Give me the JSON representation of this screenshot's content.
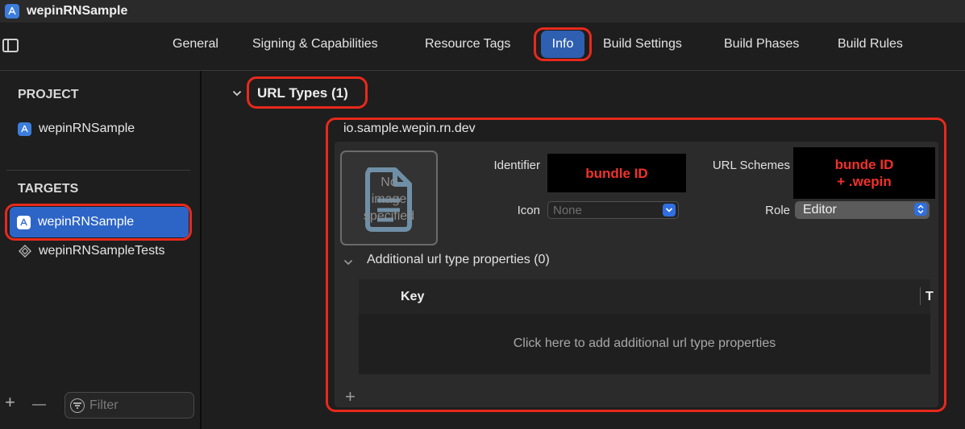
{
  "window": {
    "title": "wepinRNSample"
  },
  "tabs": [
    {
      "label": "General"
    },
    {
      "label": "Signing & Capabilities"
    },
    {
      "label": "Resource Tags"
    },
    {
      "label": "Info"
    },
    {
      "label": "Build Settings"
    },
    {
      "label": "Build Phases"
    },
    {
      "label": "Build Rules"
    }
  ],
  "sidebar": {
    "project_heading": "PROJECT",
    "project_item": "wepinRNSample",
    "targets_heading": "TARGETS",
    "targets": [
      {
        "label": "wepinRNSample"
      },
      {
        "label": "wepinRNSampleTests"
      }
    ],
    "filter_placeholder": "Filter",
    "add_label": "+",
    "remove_label": "—"
  },
  "url_types": {
    "section_title": "URL Types (1)",
    "entry_title": "io.sample.wepin.rn.dev",
    "image_placeholder": [
      "No",
      "image",
      "specified"
    ],
    "identifier_label": "Identifier",
    "identifier_value": "bundle ID",
    "url_schemes_label": "URL Schemes",
    "url_schemes_value": [
      "bunde ID",
      "+ .wepin"
    ],
    "icon_label": "Icon",
    "icon_value": "None",
    "role_label": "Role",
    "role_value": "Editor",
    "additional_label": "Additional url type properties (0)",
    "table_key_header": "Key",
    "table_type_header": "T",
    "table_empty_text": "Click here to add additional url type properties",
    "add_label": "+"
  },
  "colors": {
    "highlight": "#e8291c",
    "selection": "#2d65c7",
    "accent": "#2f6fe0",
    "redaction_text": "#f2312a"
  },
  "icons": [
    "app-icon",
    "sidebar-toggle-icon",
    "chevron-down-icon",
    "document-placeholder-icon",
    "up-down-arrows-icon",
    "filter-icon",
    "puzzle-icon"
  ]
}
